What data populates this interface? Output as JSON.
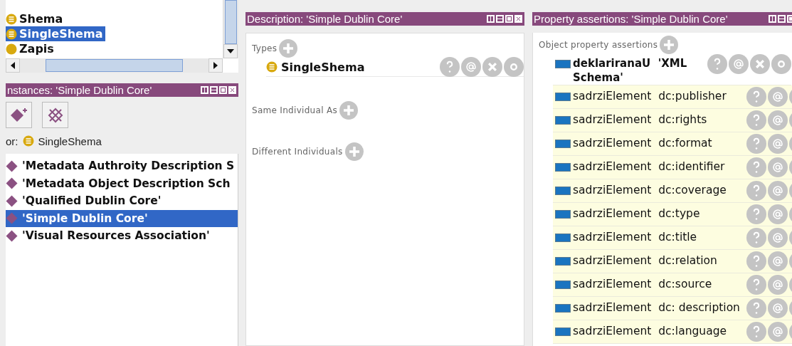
{
  "class_tree": {
    "items": [
      {
        "label": "Shema",
        "kind": "defined",
        "selected": false
      },
      {
        "label": "SingleShema",
        "kind": "defined",
        "selected": true
      },
      {
        "label": "Zapis",
        "kind": "primitive",
        "selected": false
      }
    ]
  },
  "instances_panel": {
    "title": "nstances: 'Simple Dublin Core'",
    "for_label": "or:",
    "for_class": "SingleShema",
    "items": [
      {
        "label": "'Metadata Authroity Description S",
        "selected": false
      },
      {
        "label": "'Metadata Object Description Sch",
        "selected": false
      },
      {
        "label": "'Qualified Dublin Core'",
        "selected": false
      },
      {
        "label": "'Simple Dublin Core'",
        "selected": true
      },
      {
        "label": "'Visual Resources Association'",
        "selected": false
      }
    ]
  },
  "description_panel": {
    "title": "Description: 'Simple Dublin Core'",
    "sections": [
      {
        "label": "Types",
        "entries": [
          "SingleShema"
        ]
      },
      {
        "label": "Same Individual As"
      },
      {
        "label": "Different Individuals"
      }
    ]
  },
  "property_panel": {
    "title": "Property assertions: 'Simple Dublin Core'",
    "section": "Object property assertions",
    "assertions": [
      {
        "text": "deklariranaU  'XML Schema'",
        "inferred": false
      },
      {
        "text": "sadrziElement  dc:publisher",
        "inferred": true
      },
      {
        "text": "sadrziElement  dc:rights",
        "inferred": true
      },
      {
        "text": "sadrziElement  dc:format",
        "inferred": true
      },
      {
        "text": "sadrziElement  dc:identifier",
        "inferred": true
      },
      {
        "text": "sadrziElement  dc:coverage",
        "inferred": true
      },
      {
        "text": "sadrziElement  dc:type",
        "inferred": true
      },
      {
        "text": "sadrziElement  dc:title",
        "inferred": true
      },
      {
        "text": "sadrziElement  dc:relation",
        "inferred": true
      },
      {
        "text": "sadrziElement  dc:source",
        "inferred": true
      },
      {
        "text": "sadrziElement  dc: description",
        "inferred": true
      },
      {
        "text": "sadrziElement  dc:language",
        "inferred": true
      }
    ]
  }
}
